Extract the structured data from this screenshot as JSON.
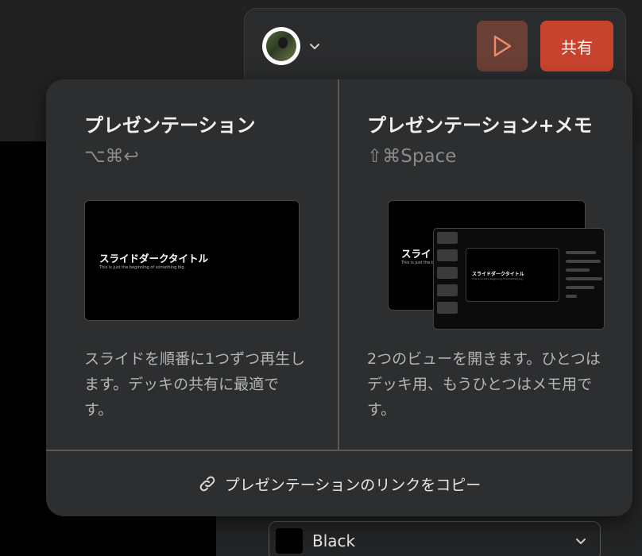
{
  "header": {
    "share_label": "共有",
    "play_icon": "play-icon",
    "avatar_icon": "user-avatar",
    "accent_color": "#c8432d"
  },
  "color_select": {
    "value": "Black",
    "swatch_color": "#000000"
  },
  "popover": {
    "options": [
      {
        "title": "プレゼンテーション",
        "shortcut": "⌥⌘↩",
        "description": "スライドを順番に1つずつ再生します。デッキの共有に最適です。",
        "thumbnail": {
          "title": "スライドダークタイトル",
          "subtitle": "This is just the beginning of something big."
        }
      },
      {
        "title": "プレゼンテーション+メモ",
        "shortcut": "⇧⌘Space",
        "description": "2つのビューを開きます。ひとつはデッキ用、もうひとつはメモ用です。",
        "thumbnail": {
          "title": "スライ",
          "subtitle": "This is just the beg",
          "inner_title": "スライドダークタイトル",
          "inner_subtitle": "This is just the beginning of something big."
        }
      }
    ],
    "copy_link_label": "プレゼンテーションのリンクをコピー",
    "link_icon": "link-icon"
  }
}
